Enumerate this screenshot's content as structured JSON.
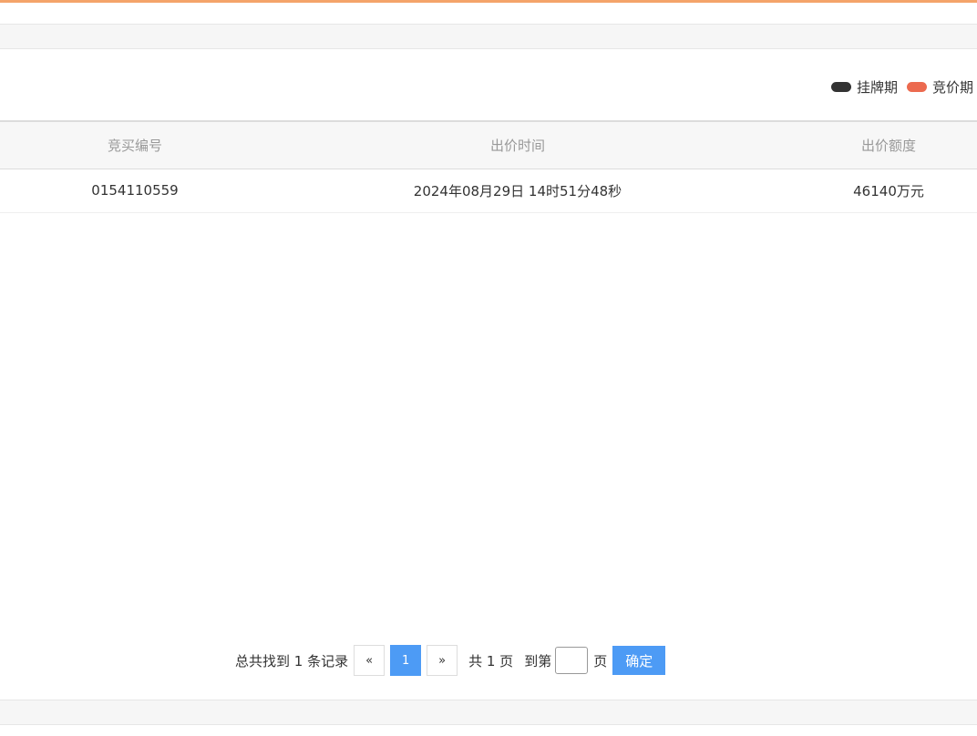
{
  "legend": {
    "items": [
      {
        "label": "挂牌期",
        "color": "#333333"
      },
      {
        "label": "竞价期",
        "color": "#ec6a4f"
      }
    ]
  },
  "table": {
    "headers": [
      "竞买编号",
      "出价时间",
      "出价额度"
    ],
    "rows": [
      [
        "0154110559",
        "2024年08月29日 14时51分48秒",
        "46140万元"
      ]
    ]
  },
  "pager": {
    "total_text": "总共找到 1 条记录",
    "prev_label": "«",
    "current_page": "1",
    "next_label": "»",
    "total_pages_text": "共 1 页",
    "goto_label": "到第",
    "page_suffix": "页",
    "goto_value": "",
    "confirm_label": "确定"
  },
  "colors": {
    "accent": "#f4a46a",
    "primary_button": "#4d9bf5"
  }
}
